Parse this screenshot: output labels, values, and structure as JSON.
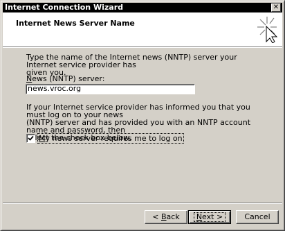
{
  "window": {
    "title": "Internet Connection Wizard",
    "close_glyph": "✕"
  },
  "header": {
    "title": "Internet News Server Name",
    "icon": "wizard-sparkle-icon"
  },
  "body": {
    "intro_text": "Type the name of the Internet news (NNTP) server your Internet service provider has\ngiven you.",
    "server_label": {
      "accel": "N",
      "rest": "ews (NNTP) server:"
    },
    "server_value": "news.vroc.org",
    "info_text": "If your Internet service provider has informed you that you must log on to your news\n(NNTP) server and has provided you with an NNTP account name and password, then\nselect the check box below.",
    "logon_checkbox": {
      "checked": true,
      "accel": "M",
      "rest": "y news server requires me to log on"
    }
  },
  "buttons": {
    "back": {
      "prefix": "< ",
      "accel": "B",
      "rest": "ack"
    },
    "next": {
      "accel": "N",
      "rest": "ext >"
    },
    "cancel": {
      "label": "Cancel"
    }
  }
}
